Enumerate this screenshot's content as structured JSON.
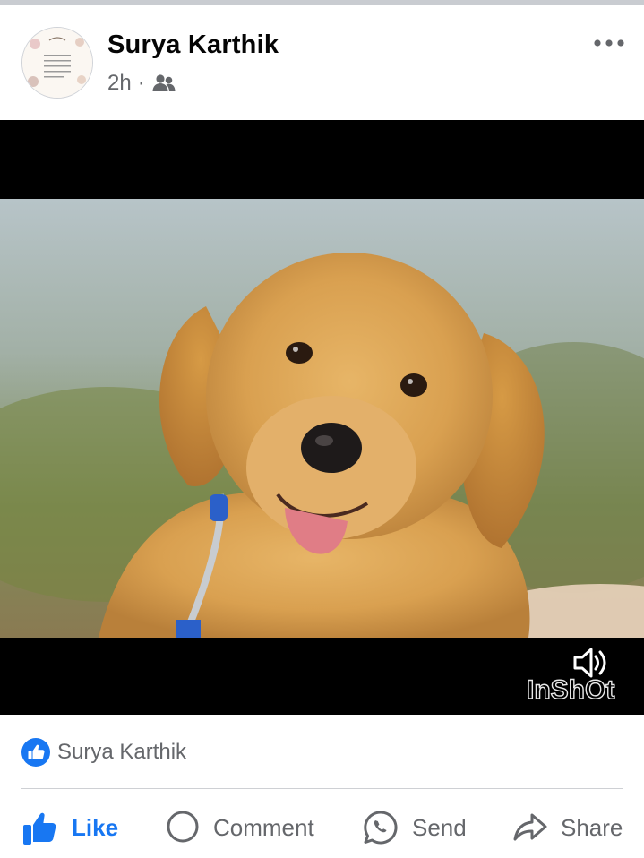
{
  "post": {
    "author": "Surya Karthik",
    "timestamp": "2h",
    "separator": "·",
    "audience_icon": "friends-icon",
    "more_icon": "more-horizontal-icon"
  },
  "video": {
    "watermark": "InShOt",
    "volume_icon": "speaker-icon"
  },
  "reactions": {
    "icon": "like-reaction-icon",
    "names": "Surya Karthik"
  },
  "actions": {
    "like": "Like",
    "comment": "Comment",
    "send": "Send",
    "share": "Share"
  },
  "colors": {
    "accent": "#1877f2",
    "secondary_text": "#65676b",
    "divider": "#ced0d4"
  }
}
